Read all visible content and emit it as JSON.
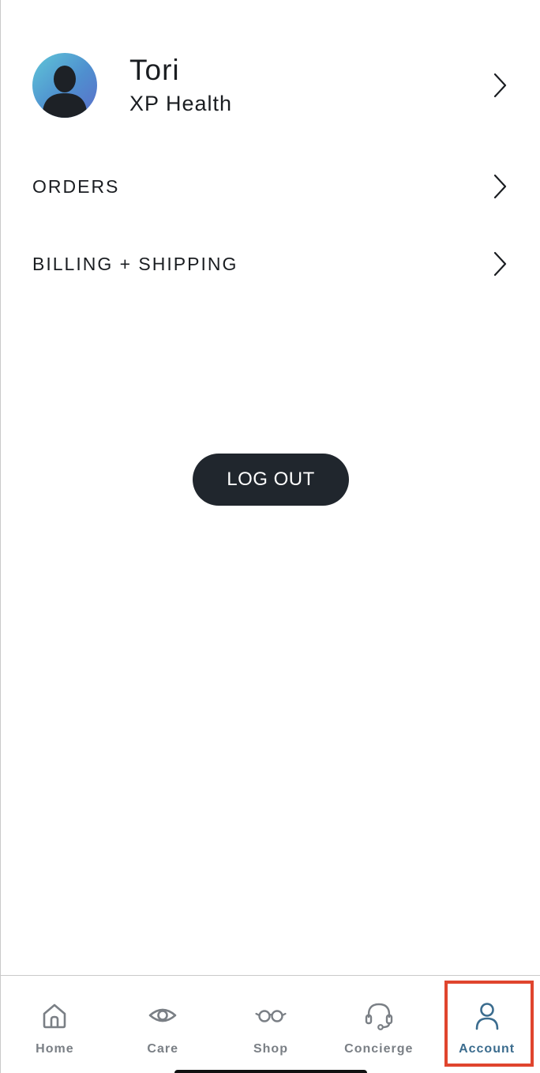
{
  "profile": {
    "name": "Tori",
    "organization": "XP Health",
    "avatar_icon": "user-silhouette-icon"
  },
  "menu": {
    "items": [
      {
        "label": "ORDERS",
        "icon": "chevron-right-icon"
      },
      {
        "label": "BILLING + SHIPPING",
        "icon": "chevron-right-icon"
      }
    ]
  },
  "logout": {
    "label": "LOG OUT"
  },
  "tabbar": {
    "tabs": [
      {
        "label": "Home",
        "icon": "home-icon",
        "active": false
      },
      {
        "label": "Care",
        "icon": "eye-icon",
        "active": false
      },
      {
        "label": "Shop",
        "icon": "glasses-icon",
        "active": false
      },
      {
        "label": "Concierge",
        "icon": "headset-icon",
        "active": false
      },
      {
        "label": "Account",
        "icon": "person-icon",
        "active": true
      }
    ]
  },
  "colors": {
    "accent": "#3b6c8e",
    "inactive": "#7a7f85",
    "button_bg": "#20262d",
    "highlight": "#e0452e"
  }
}
